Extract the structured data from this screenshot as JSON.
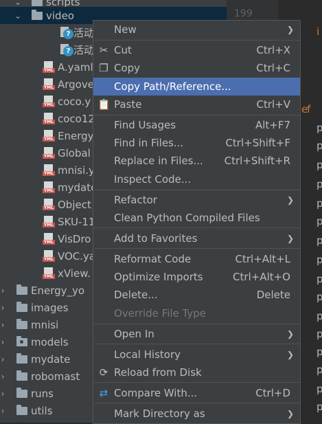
{
  "tree": [
    {
      "label": "scripts",
      "type": "folder-open",
      "indent": 40,
      "chev": "⌄"
    },
    {
      "label": "video",
      "type": "folder-open",
      "indent": 40,
      "chev": "⌄",
      "selected": true
    },
    {
      "label": "活动",
      "type": "unknown",
      "indent": 88
    },
    {
      "label": "活动",
      "type": "unknown",
      "indent": 88
    },
    {
      "label": "A.yaml",
      "type": "yml",
      "indent": 62
    },
    {
      "label": "Argove",
      "type": "yml",
      "indent": 62
    },
    {
      "label": "coco.y",
      "type": "yml",
      "indent": 62
    },
    {
      "label": "coco12",
      "type": "yml",
      "indent": 62
    },
    {
      "label": "Energy",
      "type": "yml",
      "indent": 62
    },
    {
      "label": "Global",
      "type": "yml",
      "indent": 62
    },
    {
      "label": "mnisi.y",
      "type": "yml",
      "indent": 62
    },
    {
      "label": "mydate",
      "type": "yml",
      "indent": 62
    },
    {
      "label": "Object",
      "type": "yml",
      "indent": 62
    },
    {
      "label": "SKU-11",
      "type": "yml",
      "indent": 62
    },
    {
      "label": "VisDro",
      "type": "yml",
      "indent": 62
    },
    {
      "label": "VOC.ya",
      "type": "yml",
      "indent": 62
    },
    {
      "label": "xView.",
      "type": "yml",
      "indent": 62
    },
    {
      "label": "Energy_yo",
      "type": "folder",
      "indent": 18,
      "chev": "›"
    },
    {
      "label": "images",
      "type": "folder",
      "indent": 18,
      "chev": "›"
    },
    {
      "label": "mnisi",
      "type": "folder",
      "indent": 18,
      "chev": "›"
    },
    {
      "label": "models",
      "type": "package",
      "indent": 18,
      "chev": "›"
    },
    {
      "label": "mydate",
      "type": "folder",
      "indent": 18,
      "chev": "›"
    },
    {
      "label": "robomast",
      "type": "folder",
      "indent": 18,
      "chev": "›"
    },
    {
      "label": "runs",
      "type": "folder",
      "indent": 18,
      "chev": "›"
    },
    {
      "label": "utils",
      "type": "folder",
      "indent": 18,
      "chev": "›"
    }
  ],
  "editor": {
    "line_number": "199",
    "top_char": "i",
    "def_text": "f",
    "def_prefix": "e",
    "p_char": "p"
  },
  "menu": [
    {
      "label": "New",
      "submenu": true
    },
    {
      "sep": true
    },
    {
      "label": "Cut",
      "shortcut": "Ctrl+X",
      "icon": "cut-icon",
      "glyph": "✂"
    },
    {
      "label": "Copy",
      "shortcut": "Ctrl+C",
      "icon": "copy-icon",
      "glyph": "❐"
    },
    {
      "label": "Copy Path/Reference...",
      "highlighted": true
    },
    {
      "label": "Paste",
      "shortcut": "Ctrl+V",
      "icon": "paste-icon",
      "glyph": "📋"
    },
    {
      "sep": true
    },
    {
      "label": "Find Usages",
      "shortcut": "Alt+F7"
    },
    {
      "label": "Find in Files...",
      "shortcut": "Ctrl+Shift+F"
    },
    {
      "label": "Replace in Files...",
      "shortcut": "Ctrl+Shift+R"
    },
    {
      "label": "Inspect Code..."
    },
    {
      "sep": true
    },
    {
      "label": "Refactor",
      "submenu": true
    },
    {
      "label": "Clean Python Compiled Files"
    },
    {
      "sep": true
    },
    {
      "label": "Add to Favorites",
      "submenu": true
    },
    {
      "sep": true
    },
    {
      "label": "Reformat Code",
      "shortcut": "Ctrl+Alt+L"
    },
    {
      "label": "Optimize Imports",
      "shortcut": "Ctrl+Alt+O"
    },
    {
      "label": "Delete...",
      "shortcut": "Delete"
    },
    {
      "label": "Override File Type",
      "disabled": true
    },
    {
      "sep": true
    },
    {
      "label": "Open In",
      "submenu": true
    },
    {
      "sep": true
    },
    {
      "label": "Local History",
      "submenu": true
    },
    {
      "label": "Reload from Disk",
      "icon": "reload-icon",
      "glyph": "⟳"
    },
    {
      "sep": true
    },
    {
      "label": "Compare With...",
      "shortcut": "Ctrl+D",
      "icon": "compare-icon",
      "glyph": "⇄"
    },
    {
      "sep": true
    },
    {
      "label": "Mark Directory as",
      "submenu": true
    }
  ]
}
